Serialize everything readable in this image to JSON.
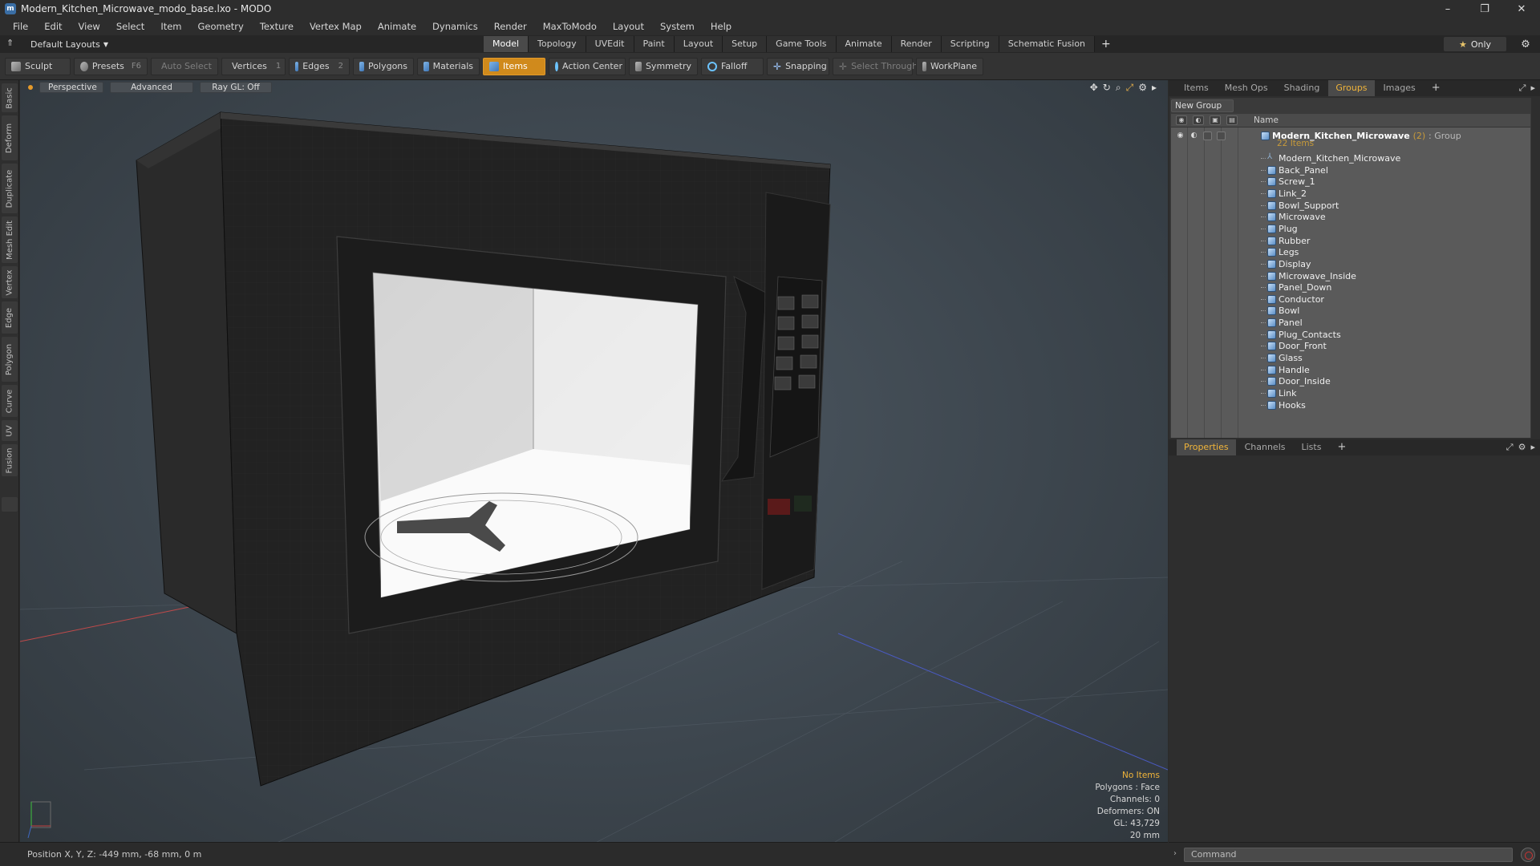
{
  "window": {
    "title": "Modern_Kitchen_Microwave_modo_base.lxo - MODO",
    "logo_letter": "m",
    "controls": [
      "–",
      "❐",
      "✕"
    ]
  },
  "menu": [
    "File",
    "Edit",
    "View",
    "Select",
    "Item",
    "Geometry",
    "Texture",
    "Vertex Map",
    "Animate",
    "Dynamics",
    "Render",
    "MaxToModo",
    "Layout",
    "System",
    "Help"
  ],
  "layout": {
    "dropdown": "Default Layouts",
    "tabs": [
      "Model",
      "Topology",
      "UVEdit",
      "Paint",
      "Layout",
      "Setup",
      "Game Tools",
      "Animate",
      "Render",
      "Scripting",
      "Schematic Fusion"
    ],
    "active_tab": "Model",
    "only_label": "Only"
  },
  "toolbar": {
    "sculpt": "Sculpt",
    "presets": "Presets",
    "presets_shortcut": "F6",
    "auto_select": "Auto Select",
    "vertices": "Vertices",
    "vertices_count": "1",
    "edges": "Edges",
    "edges_count": "2",
    "polygons": "Polygons",
    "materials": "Materials",
    "items": "Items",
    "action_center": "Action Center",
    "symmetry": "Symmetry",
    "falloff": "Falloff",
    "snapping": "Snapping",
    "select_through": "Select Through",
    "workplane": "WorkPlane"
  },
  "left_tabs": [
    "Basic",
    "Deform",
    "Duplicate",
    "Mesh Edit",
    "Vertex",
    "Edge",
    "Polygon",
    "Curve",
    "UV",
    "Fusion"
  ],
  "viewport": {
    "perspective": "Perspective",
    "advanced": "Advanced",
    "raygl": "Ray GL: Off",
    "stats": {
      "no_items": "No Items",
      "polygons": "Polygons : Face",
      "channels": "Channels: 0",
      "deformers": "Deformers: ON",
      "gl": "GL: 43,729",
      "grid": "20 mm"
    }
  },
  "status": {
    "position": "Position X, Y, Z:  -449 mm, -68 mm, 0 m"
  },
  "right_panel": {
    "top_tabs": [
      "Items",
      "Mesh Ops",
      "Shading",
      "Groups",
      "Images"
    ],
    "active_top_tab": "Groups",
    "new_group": "New Group",
    "col_name": "Name",
    "root": {
      "name": "Modern_Kitchen_Microwave",
      "count": "(2)",
      "type": ": Group",
      "sub": "22 Items"
    },
    "items": [
      "Modern_Kitchen_Microwave",
      "Back_Panel",
      "Screw_1",
      "Link_2",
      "Bowl_Support",
      "Microwave",
      "Plug",
      "Rubber",
      "Legs",
      "Display",
      "Microwave_Inside",
      "Panel_Down",
      "Conductor",
      "Bowl",
      "Panel",
      "Plug_Contacts",
      "Door_Front",
      "Glass",
      "Handle",
      "Door_Inside",
      "Link",
      "Hooks"
    ],
    "bottom_tabs": [
      "Properties",
      "Channels",
      "Lists"
    ],
    "active_bottom_tab": "Properties",
    "command_placeholder": "Command"
  },
  "colors": {
    "accent": "#d08a1c",
    "active_tab_text": "#f0b43a",
    "viewport_bg": "#3d464e"
  }
}
